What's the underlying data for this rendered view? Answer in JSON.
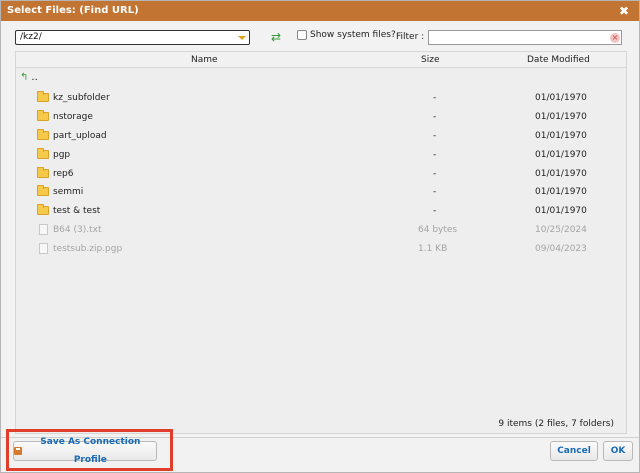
{
  "dialog": {
    "title": "Select Files: (Find URL)",
    "close_glyph": "✖"
  },
  "toolbar": {
    "path_value": "/kz2/",
    "show_system_files_label": "Show system files?",
    "show_system_files_checked": false,
    "filter_label": "Filter :",
    "filter_value": "",
    "refresh_icon": "refresh-icon",
    "clear_icon": "clear-filter-icon"
  },
  "grid": {
    "columns": {
      "name": "Name",
      "size": "Size",
      "date": "Date Modified"
    },
    "up_label": "..",
    "rows": [
      {
        "type": "folder",
        "name": "kz_subfolder",
        "size": "-",
        "date": "01/01/1970"
      },
      {
        "type": "folder",
        "name": "nstorage",
        "size": "-",
        "date": "01/01/1970"
      },
      {
        "type": "folder",
        "name": "part_upload",
        "size": "-",
        "date": "01/01/1970"
      },
      {
        "type": "folder",
        "name": "pgp",
        "size": "-",
        "date": "01/01/1970"
      },
      {
        "type": "folder",
        "name": "rep6",
        "size": "-",
        "date": "01/01/1970"
      },
      {
        "type": "folder",
        "name": "semmi",
        "size": "-",
        "date": "01/01/1970"
      },
      {
        "type": "folder",
        "name": "test & test",
        "size": "-",
        "date": "01/01/1970"
      },
      {
        "type": "file",
        "name": "B64 (3).txt",
        "size": "64 bytes",
        "date": "10/25/2024"
      },
      {
        "type": "file",
        "name": "testsub.zip.pgp",
        "size": "1.1 KB",
        "date": "09/04/2023"
      }
    ],
    "summary": "9 items (2 files, 7 folders)"
  },
  "footer": {
    "save_profile_label": "Save As Connection Profile",
    "cancel_label": "Cancel",
    "ok_label": "OK"
  },
  "colors": {
    "titlebar": "#c27532",
    "button_text": "#1a6bb5",
    "highlight": "#e03d2b",
    "folder": "#f6c94a"
  }
}
